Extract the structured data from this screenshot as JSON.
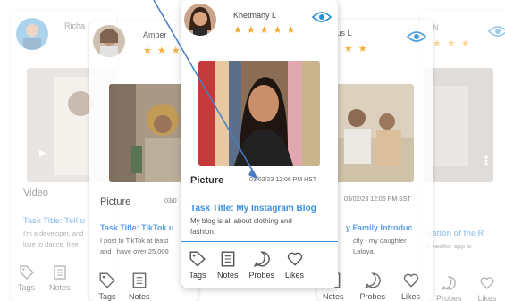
{
  "cards": {
    "back_left": {
      "name": "Richa",
      "type": "Video",
      "task_title": "Task Title: Tell u",
      "desc_line1": "I'm a developer, and",
      "desc_line2": "love to dance, free"
    },
    "back_right": {
      "name": "N",
      "task_title": "gation of the R",
      "desc_line1": "e realtor app is"
    },
    "left": {
      "name": "Amber",
      "type": "Picture",
      "date": "03/0",
      "task_title": "Task Title: TikTok u",
      "desc_line1": "I post to TikTok at least",
      "desc_line2": "and I have over 25,000"
    },
    "right": {
      "name": "rcus L",
      "date": "03/02/23 12:06 PM SST",
      "task_title": "y Family Introduc",
      "desc_line1": "ctly - my daughter",
      "desc_line2": "Latoya."
    },
    "front": {
      "name": "Khetmany L",
      "type": "Picture",
      "date": "03/02/23 12:06 PM HST",
      "task_title": "Task Title: My Instagram Blog",
      "desc_line1": "My blog is all about clothing and",
      "desc_line2": "fashion."
    }
  },
  "actions": {
    "tags": "Tags",
    "notes": "Notes",
    "probes": "Probes",
    "likes": "Likes"
  },
  "star_char": "★",
  "rating": 5,
  "colors": {
    "accent": "#3a8ee0",
    "star": "#f5a623",
    "eye": "#2a8fd4",
    "icon": "#555555",
    "arrow": "#4a7cc4"
  }
}
